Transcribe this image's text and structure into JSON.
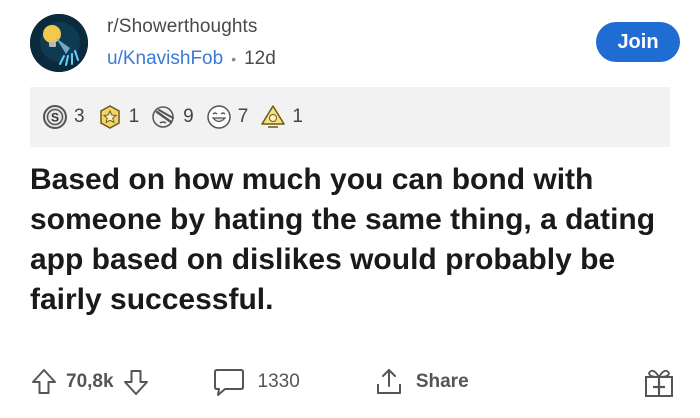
{
  "header": {
    "subreddit": "r/Showerthoughts",
    "username": "u/KnavishFob",
    "separator": "•",
    "age": "12d",
    "join_label": "Join"
  },
  "awards": [
    {
      "icon": "silver-award-icon",
      "count": "3"
    },
    {
      "icon": "helpful-award-icon",
      "count": "1"
    },
    {
      "icon": "facepalm-award-icon",
      "count": "9"
    },
    {
      "icon": "laughing-award-icon",
      "count": "7"
    },
    {
      "icon": "take-my-energy-award-icon",
      "count": "1"
    }
  ],
  "post": {
    "title": "Based on how much you can bond with someone by hating the same thing, a dating app based on dislikes would probably be fairly successful."
  },
  "actions": {
    "score": "70,8k",
    "comments": "1330",
    "share_label": "Share"
  },
  "colors": {
    "accent": "#1f6cd3",
    "username": "#3a7bd5",
    "awards_bg": "#f2f2f2"
  }
}
